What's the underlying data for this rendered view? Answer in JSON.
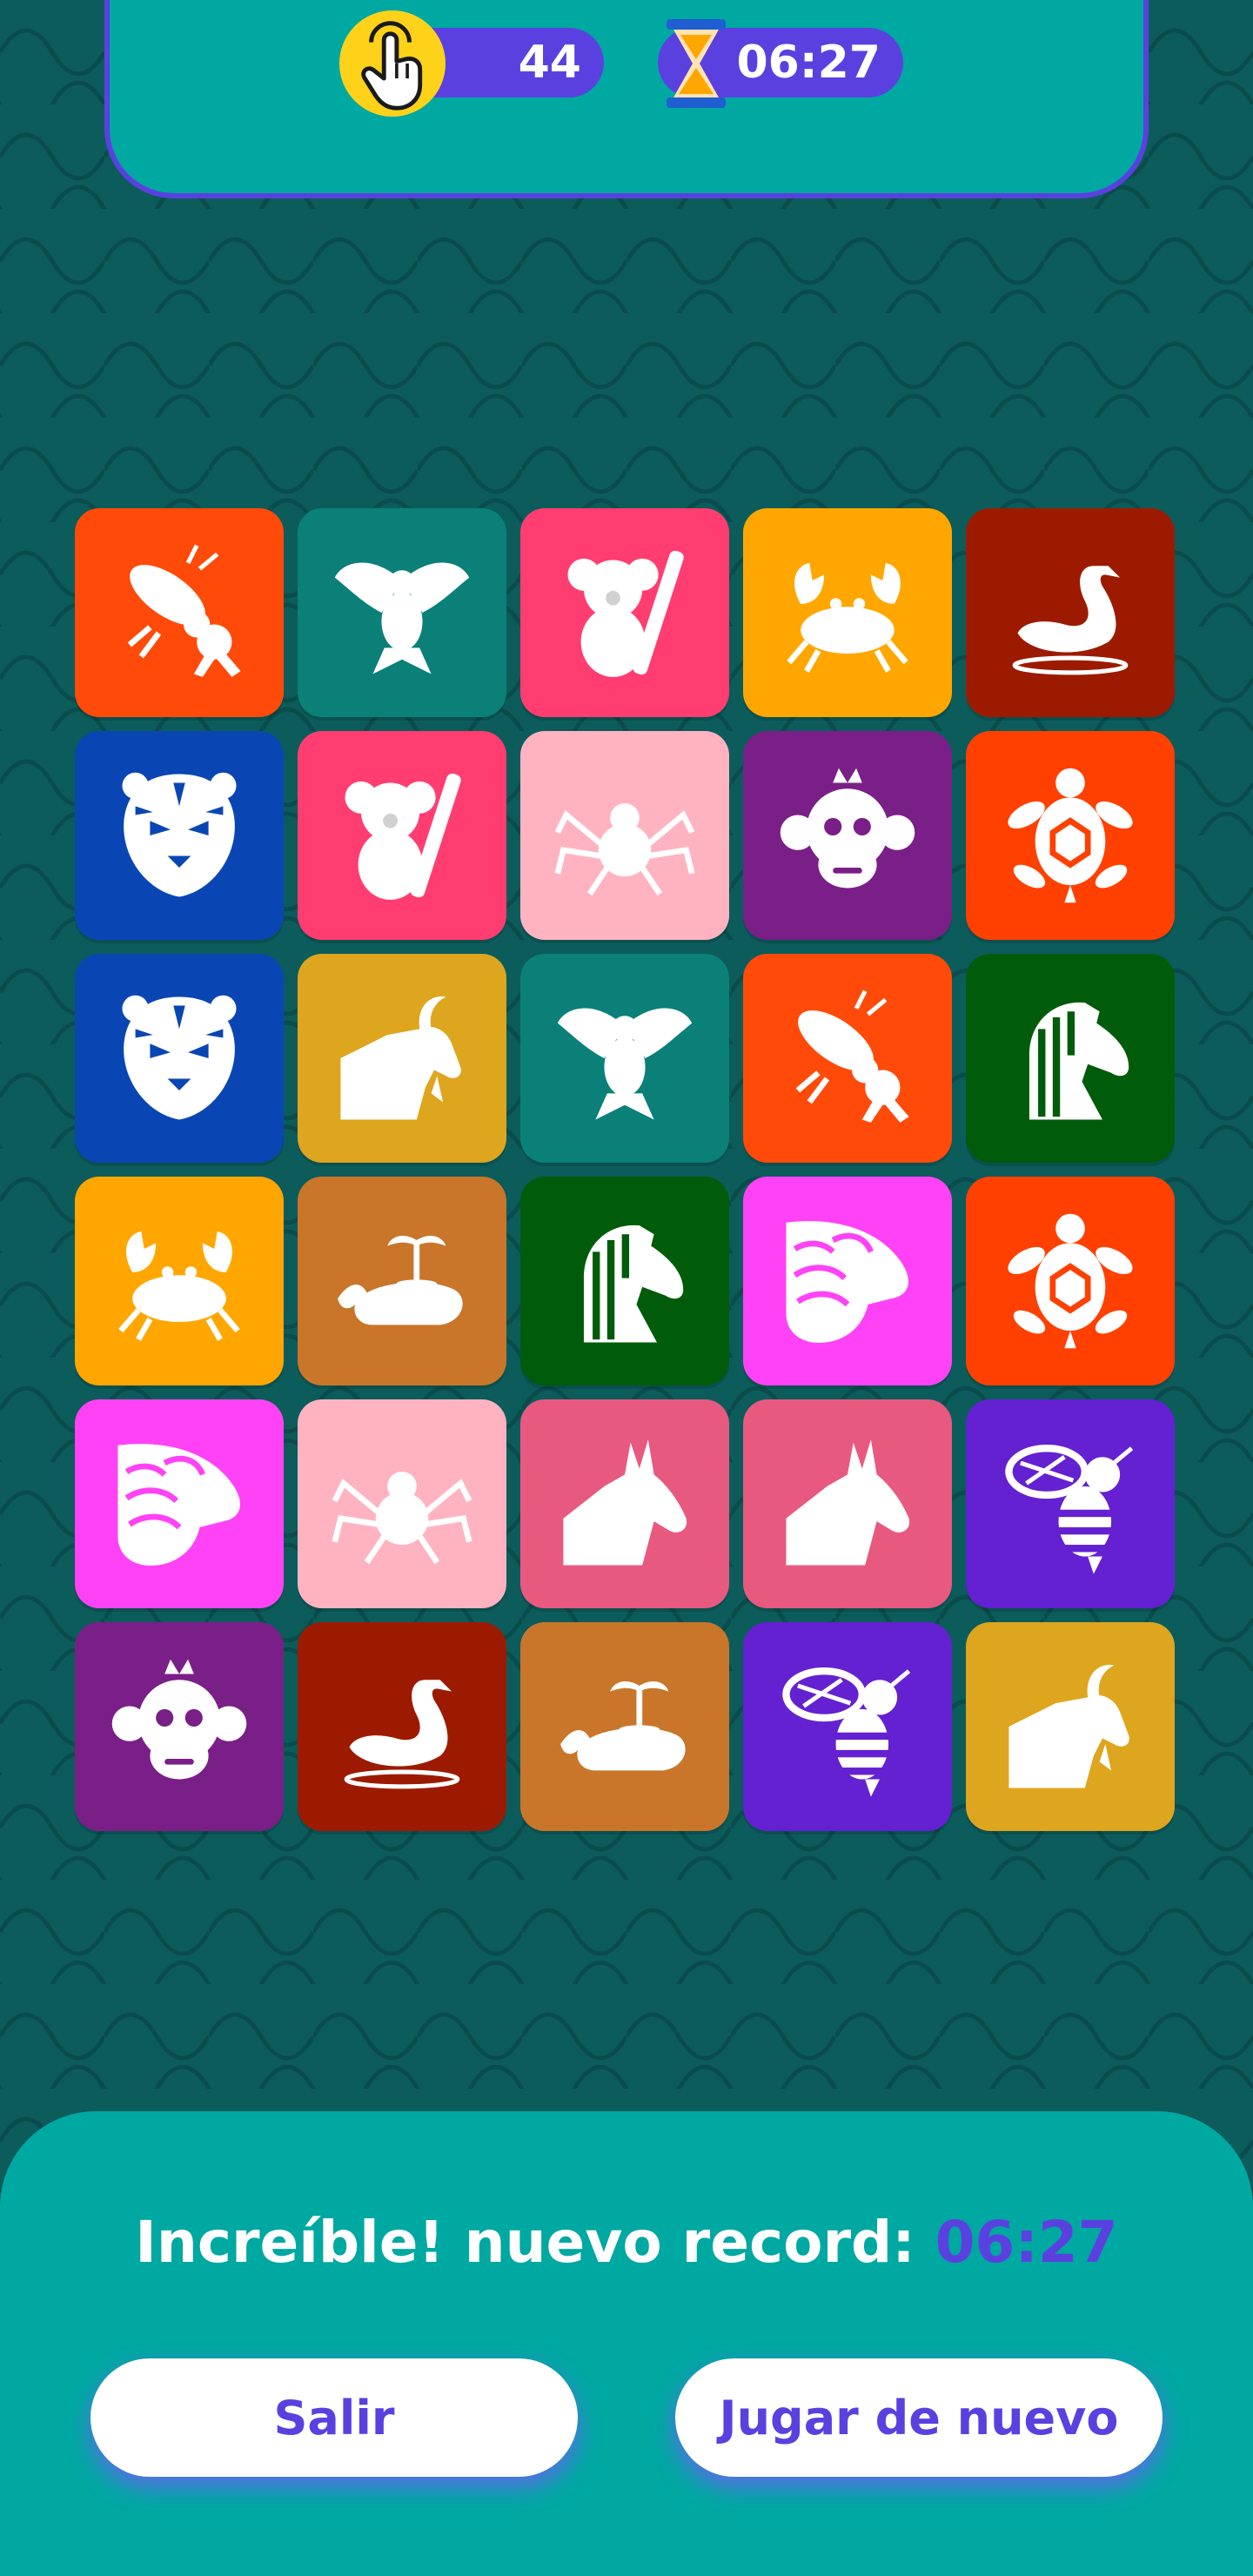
{
  "hud": {
    "moves": "44",
    "moves_icon": "tap-finger-icon",
    "time": "06:27",
    "time_icon": "hourglass-icon"
  },
  "board": {
    "rows": [
      [
        {
          "animal": "cricket",
          "color": "#ff4a0a"
        },
        {
          "animal": "eagle",
          "color": "#0a8078"
        },
        {
          "animal": "koala",
          "color": "#ff3d70"
        },
        {
          "animal": "crab",
          "color": "#ffa600"
        },
        {
          "animal": "swan",
          "color": "#9c1b00"
        }
      ],
      [
        {
          "animal": "tiger",
          "color": "#0a46b3"
        },
        {
          "animal": "koala",
          "color": "#ff3d70"
        },
        {
          "animal": "spider",
          "color": "#ffb3c1"
        },
        {
          "animal": "monkey",
          "color": "#7a1f87"
        },
        {
          "animal": "turtle",
          "color": "#ff4000"
        }
      ],
      [
        {
          "animal": "tiger",
          "color": "#0a46b3"
        },
        {
          "animal": "goat",
          "color": "#dea51f"
        },
        {
          "animal": "eagle",
          "color": "#0a8078"
        },
        {
          "animal": "cricket",
          "color": "#ff4a0a"
        },
        {
          "animal": "horse",
          "color": "#005c0a"
        }
      ],
      [
        {
          "animal": "crab",
          "color": "#ffa600"
        },
        {
          "animal": "whale",
          "color": "#c9762a"
        },
        {
          "animal": "horse",
          "color": "#005c0a"
        },
        {
          "animal": "pangolin",
          "color": "#ff42f5"
        },
        {
          "animal": "turtle",
          "color": "#ff4000"
        }
      ],
      [
        {
          "animal": "pangolin",
          "color": "#ff42f5"
        },
        {
          "animal": "spider",
          "color": "#ffb3c1"
        },
        {
          "animal": "donkey",
          "color": "#e85980"
        },
        {
          "animal": "donkey",
          "color": "#e85980"
        },
        {
          "animal": "wasp",
          "color": "#6421d1"
        }
      ],
      [
        {
          "animal": "monkey",
          "color": "#7a1f87"
        },
        {
          "animal": "swan",
          "color": "#9c1b00"
        },
        {
          "animal": "whale",
          "color": "#c9762a"
        },
        {
          "animal": "wasp",
          "color": "#6421d1"
        },
        {
          "animal": "goat",
          "color": "#dea51f"
        }
      ]
    ]
  },
  "result": {
    "message": "Increíble! nuevo record: ",
    "record_time": "06:27"
  },
  "buttons": {
    "exit": "Salir",
    "play_again": "Jugar de nuevo"
  },
  "colors": {
    "background": "#0c5c5c",
    "panel": "#00a8a2",
    "accent": "#5b40e0",
    "coin": "#ffd21a"
  }
}
